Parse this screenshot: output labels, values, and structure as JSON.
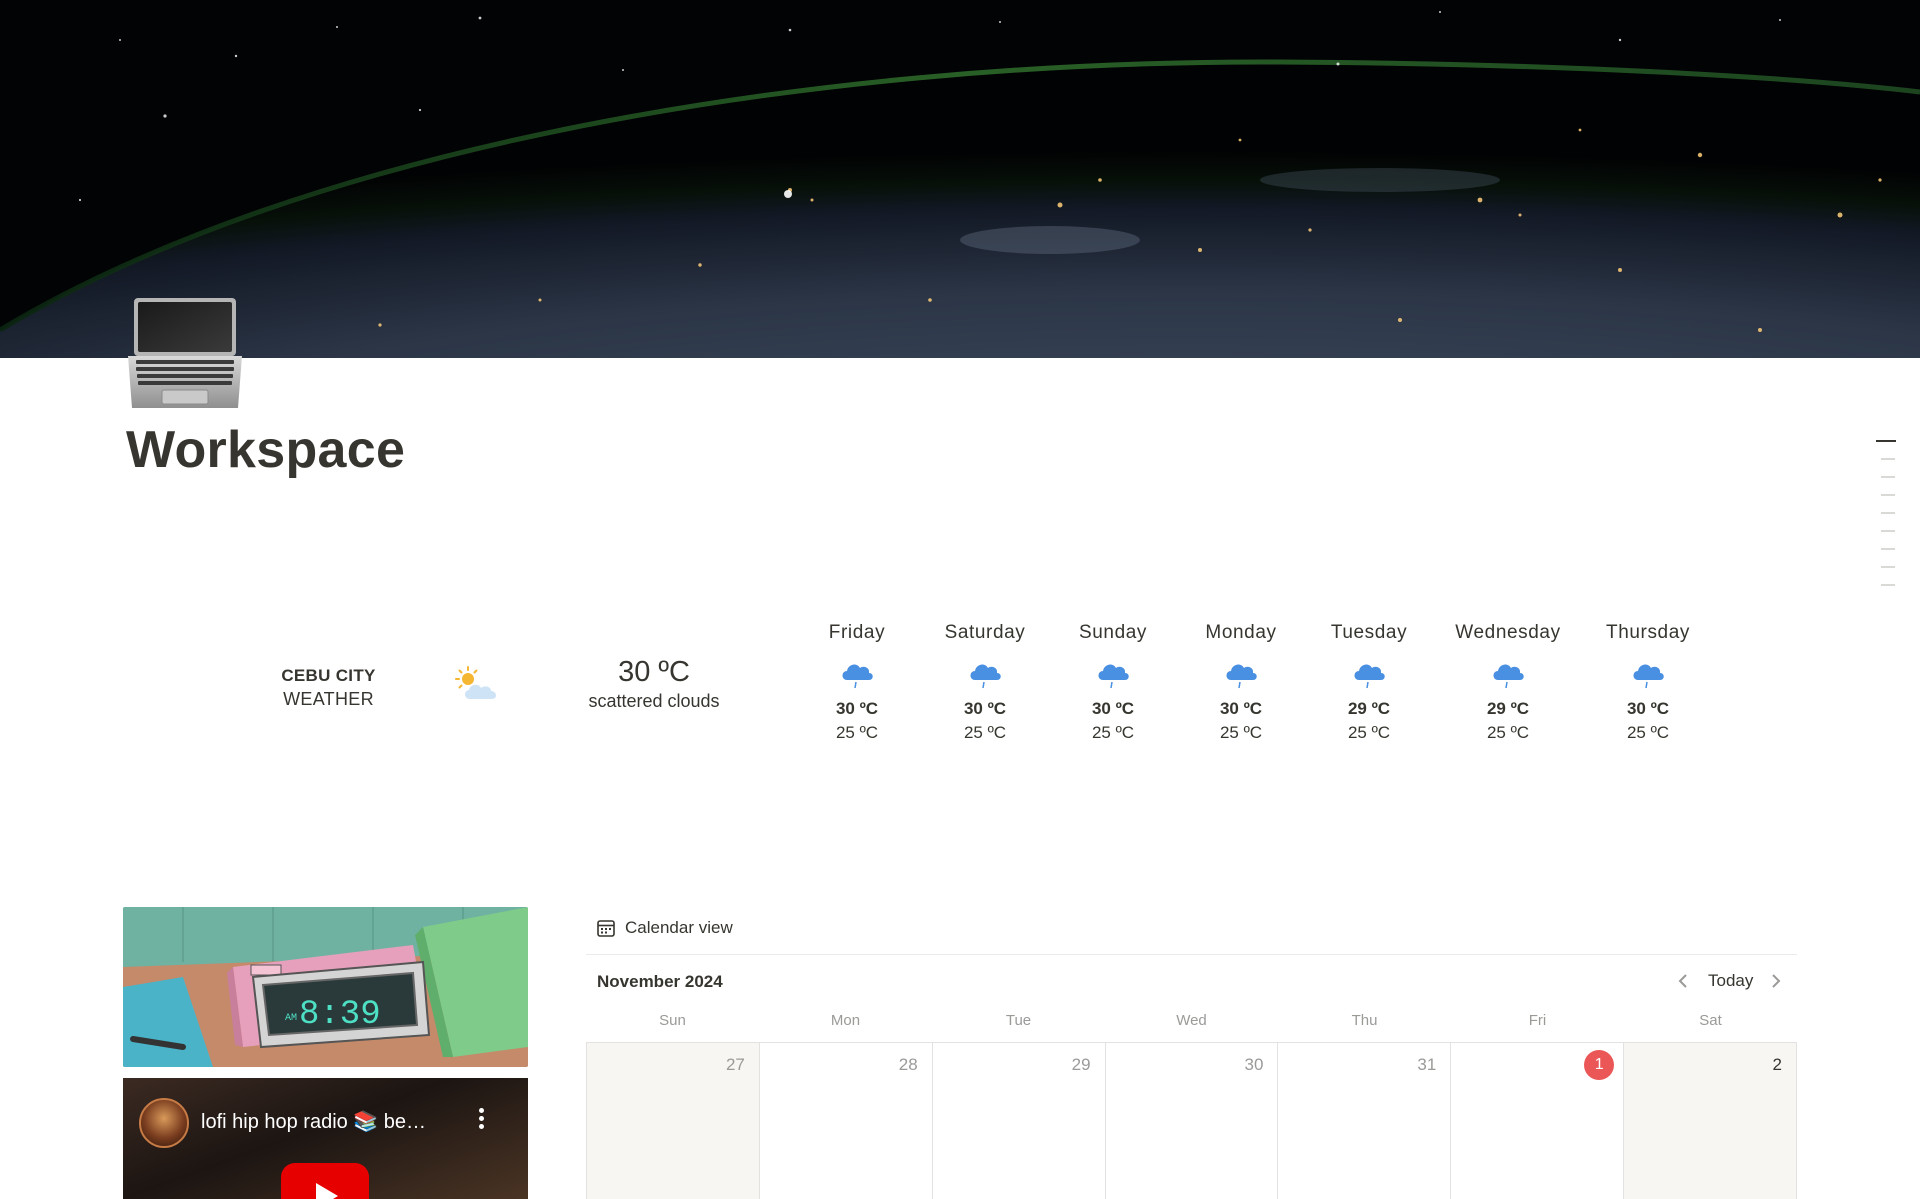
{
  "page": {
    "title": "Workspace",
    "icon": "laptop-icon"
  },
  "weather": {
    "city": "CEBU CITY",
    "label": "WEATHER",
    "current_icon": "partly-cloudy-icon",
    "current_temp": "30 ºC",
    "current_desc": "scattered clouds",
    "forecast": [
      {
        "day": "Friday",
        "icon": "rain-cloud-icon",
        "high": "30 ºC",
        "low": "25 ºC"
      },
      {
        "day": "Saturday",
        "icon": "rain-cloud-icon",
        "high": "30 ºC",
        "low": "25 ºC"
      },
      {
        "day": "Sunday",
        "icon": "rain-cloud-icon",
        "high": "30 ºC",
        "low": "25 ºC"
      },
      {
        "day": "Monday",
        "icon": "rain-cloud-icon",
        "high": "30 ºC",
        "low": "25 ºC"
      },
      {
        "day": "Tuesday",
        "icon": "rain-cloud-icon",
        "high": "29 ºC",
        "low": "25 ºC"
      },
      {
        "day": "Wednesday",
        "icon": "rain-cloud-icon",
        "high": "29 ºC",
        "low": "25 ºC"
      },
      {
        "day": "Thursday",
        "icon": "rain-cloud-icon",
        "high": "30 ºC",
        "low": "25 ºC"
      }
    ]
  },
  "media": {
    "clock_time": "8:39",
    "clock_ampm": "AM",
    "video_title": "lofi hip hop radio 📚 be…"
  },
  "calendar": {
    "view_label": "Calendar view",
    "month": "November 2024",
    "today_label": "Today",
    "weekdays": [
      "Sun",
      "Mon",
      "Tue",
      "Wed",
      "Thu",
      "Fri",
      "Sat"
    ],
    "days": [
      {
        "num": "27",
        "state": "muted"
      },
      {
        "num": "28",
        "state": "muted-white"
      },
      {
        "num": "29",
        "state": "muted-white"
      },
      {
        "num": "30",
        "state": "muted-white"
      },
      {
        "num": "31",
        "state": "muted-white"
      },
      {
        "num": "1",
        "state": "today"
      },
      {
        "num": "2",
        "state": "current-weekend"
      }
    ]
  },
  "colors": {
    "accent_today": "#eb5757",
    "weather_icon": "#4a90e2",
    "text": "#37352f",
    "muted_text": "#9b9a97"
  }
}
